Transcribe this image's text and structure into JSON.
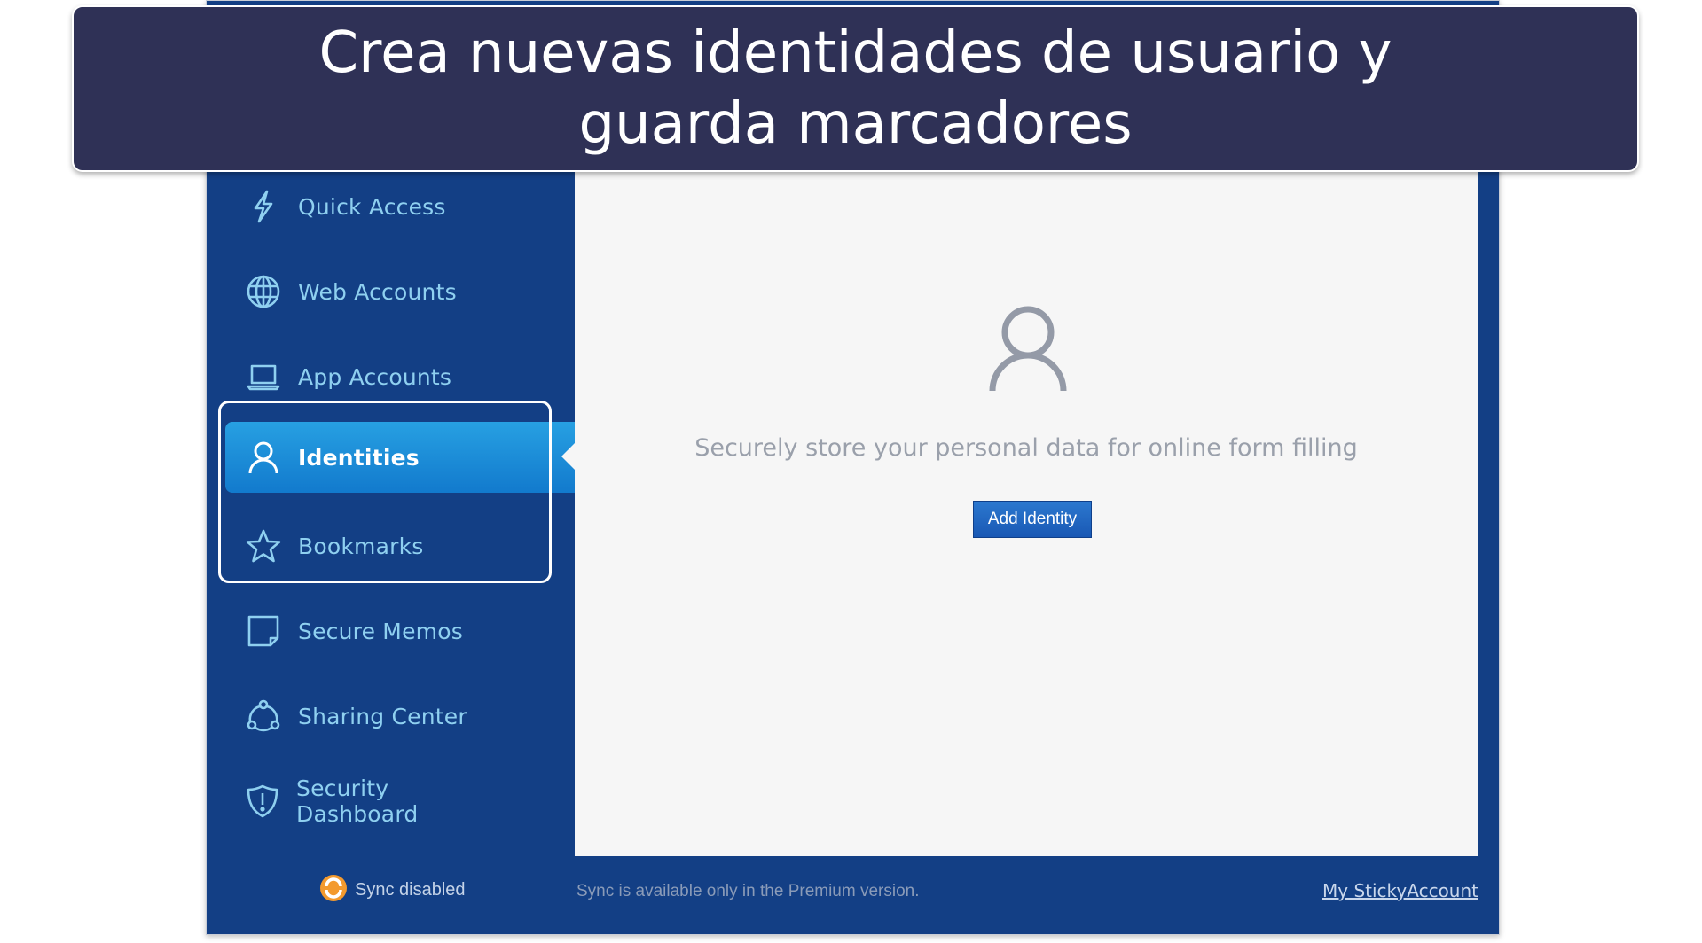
{
  "banner": {
    "title": "Crea nuevas identidades de usuario y guarda marcadores"
  },
  "window_controls": {
    "maximize_icon": "maximize-icon",
    "close_icon": "close-icon"
  },
  "sidebar": {
    "active_item": "Identities",
    "items": [
      {
        "label": "Quick Access",
        "icon": "lightning-icon"
      },
      {
        "label": "Web Accounts",
        "icon": "globe-icon"
      },
      {
        "label": "App Accounts",
        "icon": "laptop-icon"
      },
      {
        "label": "Identities",
        "icon": "user-icon"
      },
      {
        "label": "Bookmarks",
        "icon": "star-icon"
      },
      {
        "label": "Secure Memos",
        "icon": "note-icon"
      },
      {
        "label": "Sharing Center",
        "icon": "share-icon"
      },
      {
        "label": "Security Dashboard",
        "icon": "shield-icon"
      }
    ]
  },
  "main": {
    "empty_state_icon": "user-icon",
    "empty_state_text": "Securely store your personal data for online form filling",
    "add_button_label": "Add Identity"
  },
  "footer": {
    "sync_status": "Sync disabled",
    "sync_icon": "sync-icon",
    "message": "Sync is available only in the Premium version.",
    "account_link": "My StickyAccount"
  },
  "colors": {
    "banner_bg": "#2f3156",
    "sidebar_bg": "#133f85",
    "active_item": "#1a8ad8",
    "sidebar_text": "#8fd0f0",
    "content_bg": "#f6f6f6",
    "button_bg": "#1f66c2",
    "sync_orange": "#f39a2e"
  }
}
